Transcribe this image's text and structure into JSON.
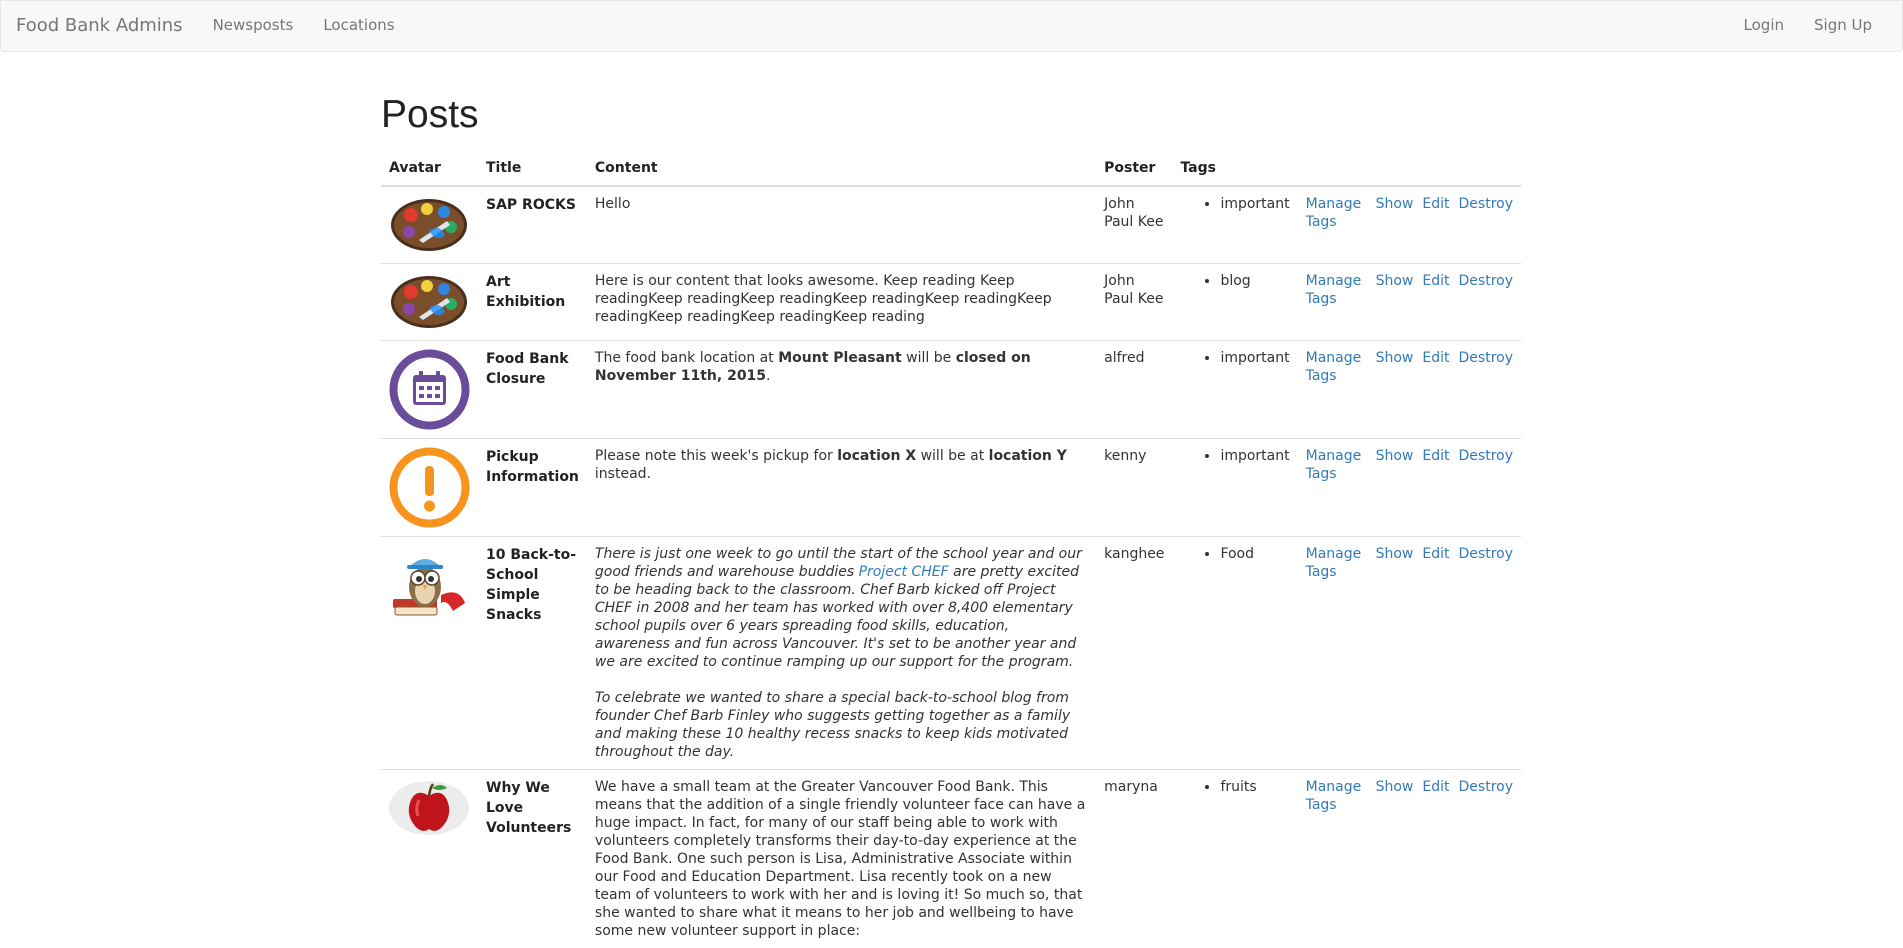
{
  "navbar": {
    "brand": "Food Bank Admins",
    "links": [
      "Newsposts",
      "Locations"
    ],
    "right_links": [
      "Login",
      "Sign Up"
    ]
  },
  "page_title": "Posts",
  "table": {
    "headers": [
      "Avatar",
      "Title",
      "Content",
      "Poster",
      "Tags"
    ],
    "rows": [
      {
        "avatar_icon": "art-palette-icon",
        "title": "SAP ROCKS",
        "content": "Hello",
        "poster": "John Paul Kee",
        "tags": [
          "important"
        ]
      },
      {
        "avatar_icon": "art-palette-icon",
        "title": "Art Exhibition",
        "content": "Here is our content that looks awesome. Keep reading Keep readingKeep readingKeep readingKeep readingKeep readingKeep readingKeep readingKeep readingKeep reading",
        "poster": "John Paul Kee",
        "tags": [
          "blog"
        ]
      },
      {
        "avatar_icon": "calendar-icon",
        "title": "Food Bank Closure",
        "content_parts": [
          "The food bank location at ",
          "Mount Pleasant",
          " will be ",
          "closed on November 11th, 2015",
          "."
        ],
        "poster": "alfred",
        "tags": [
          "important"
        ]
      },
      {
        "avatar_icon": "exclamation-icon",
        "title": "Pickup Information",
        "content_parts": [
          "Please note this week's pickup for ",
          "location X",
          " will be at ",
          "location Y",
          " instead."
        ],
        "poster": "kenny",
        "tags": [
          "important"
        ]
      },
      {
        "avatar_icon": "owl-school-icon",
        "title": "10 Back-to-School Simple Snacks",
        "content_p1_parts": [
          "There is just one week to go until the start of the school year and our good friends and warehouse buddies ",
          "Project CHEF",
          " are pretty excited to be heading back to the classroom. Chef Barb kicked off Project CHEF in 2008 and her team has worked with over 8,400 elementary school pupils over 6 years spreading food skills, education, awareness and fun across Vancouver. It's set to be another year and we are excited to continue ramping up our support for the program."
        ],
        "content_p2": "To celebrate we wanted to share a special back-to-school blog from founder Chef Barb Finley who suggests getting together as a family and making these 10 healthy recess snacks to keep kids motivated throughout the day.",
        "poster": "kanghee",
        "tags": [
          "Food"
        ]
      },
      {
        "avatar_icon": "apple-icon",
        "title": "Why We Love Volunteers",
        "content": "We have a small team at the Greater Vancouver Food Bank. This means that the addition of a single friendly volunteer face can have a huge impact. In fact, for many of our staff being able to work with volunteers completely transforms their day-to-day experience at the Food Bank. One such person is Lisa, Administrative Associate within our Food and Education Department. Lisa recently took on a new team of volunteers to work with her and is loving it! So much so, that she wanted to share what it means to her job and wellbeing to have some new volunteer support in place:",
        "poster": "maryna",
        "tags": [
          "fruits"
        ]
      }
    ],
    "actions": {
      "manage_tags": "Manage Tags",
      "show": "Show",
      "edit": "Edit",
      "destroy": "Destroy"
    }
  },
  "colors": {
    "link": "#337ab7",
    "navbar_bg": "#f8f8f8",
    "calendar_purple": "#6b4c9a",
    "alert_orange": "#f7941e"
  }
}
